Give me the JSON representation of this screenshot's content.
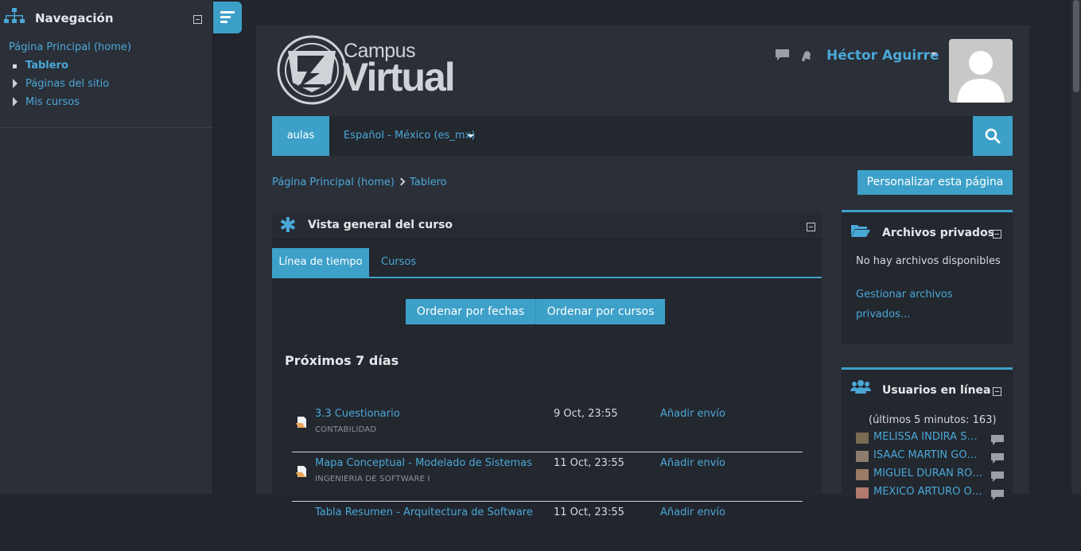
{
  "drawer": {
    "title": "Navegación",
    "items": [
      {
        "label": "Página Principal (home)"
      },
      {
        "label": "Tablero"
      },
      {
        "label": "Páginas del sitio"
      },
      {
        "label": "Mis cursos"
      }
    ]
  },
  "header": {
    "logo_line1": "Campus",
    "logo_line2": "Virtual",
    "user_name": "Héctor Aguirre"
  },
  "navbar": {
    "aulas": "aulas",
    "language": "Español - México (es_mx)"
  },
  "breadcrumb": {
    "home": "Página Principal (home)",
    "current": "Tablero"
  },
  "customize_button": "Personalizar esta página",
  "overview": {
    "title": "Vista general del curso",
    "tabs": [
      "Línea de tiempo",
      "Cursos"
    ],
    "sort_buttons": [
      "Ordenar por fechas",
      "Ordenar por cursos"
    ],
    "section_title": "Próximos 7 días",
    "events": [
      {
        "name": "3.3 Cuestionario",
        "course": "CONTABILIDAD",
        "date": "9 Oct, 23:55",
        "action": "Añadir envío"
      },
      {
        "name": "Mapa Conceptual - Modelado de Sistemas",
        "course": "INGENIERIA DE SOFTWARE I",
        "date": "11 Oct, 23:55",
        "action": "Añadir envío"
      },
      {
        "name": "Tabla Resumen - Arquitectura de Software",
        "course": "",
        "date": "11 Oct, 23:55",
        "action": "Añadir envío"
      }
    ]
  },
  "private_files": {
    "title": "Archivos privados",
    "empty": "No hay archivos disponibles",
    "manage_line1": "Gestionar archivos",
    "manage_line2": "privados..."
  },
  "online_users": {
    "title": "Usuarios en línea",
    "subtitle": "(últimos 5 minutos: 163)",
    "users": [
      {
        "name": "MELISSA INDIRA SAE..."
      },
      {
        "name": "ISAAC MARTIN GONZ..."
      },
      {
        "name": "MIGUEL DURAN ROD..."
      },
      {
        "name": "MEXICO ARTURO OR..."
      }
    ]
  },
  "colors": {
    "accent": "#3da0c9",
    "link": "#4aa8d8",
    "background": "#22252d",
    "panel": "#2b2f38"
  }
}
